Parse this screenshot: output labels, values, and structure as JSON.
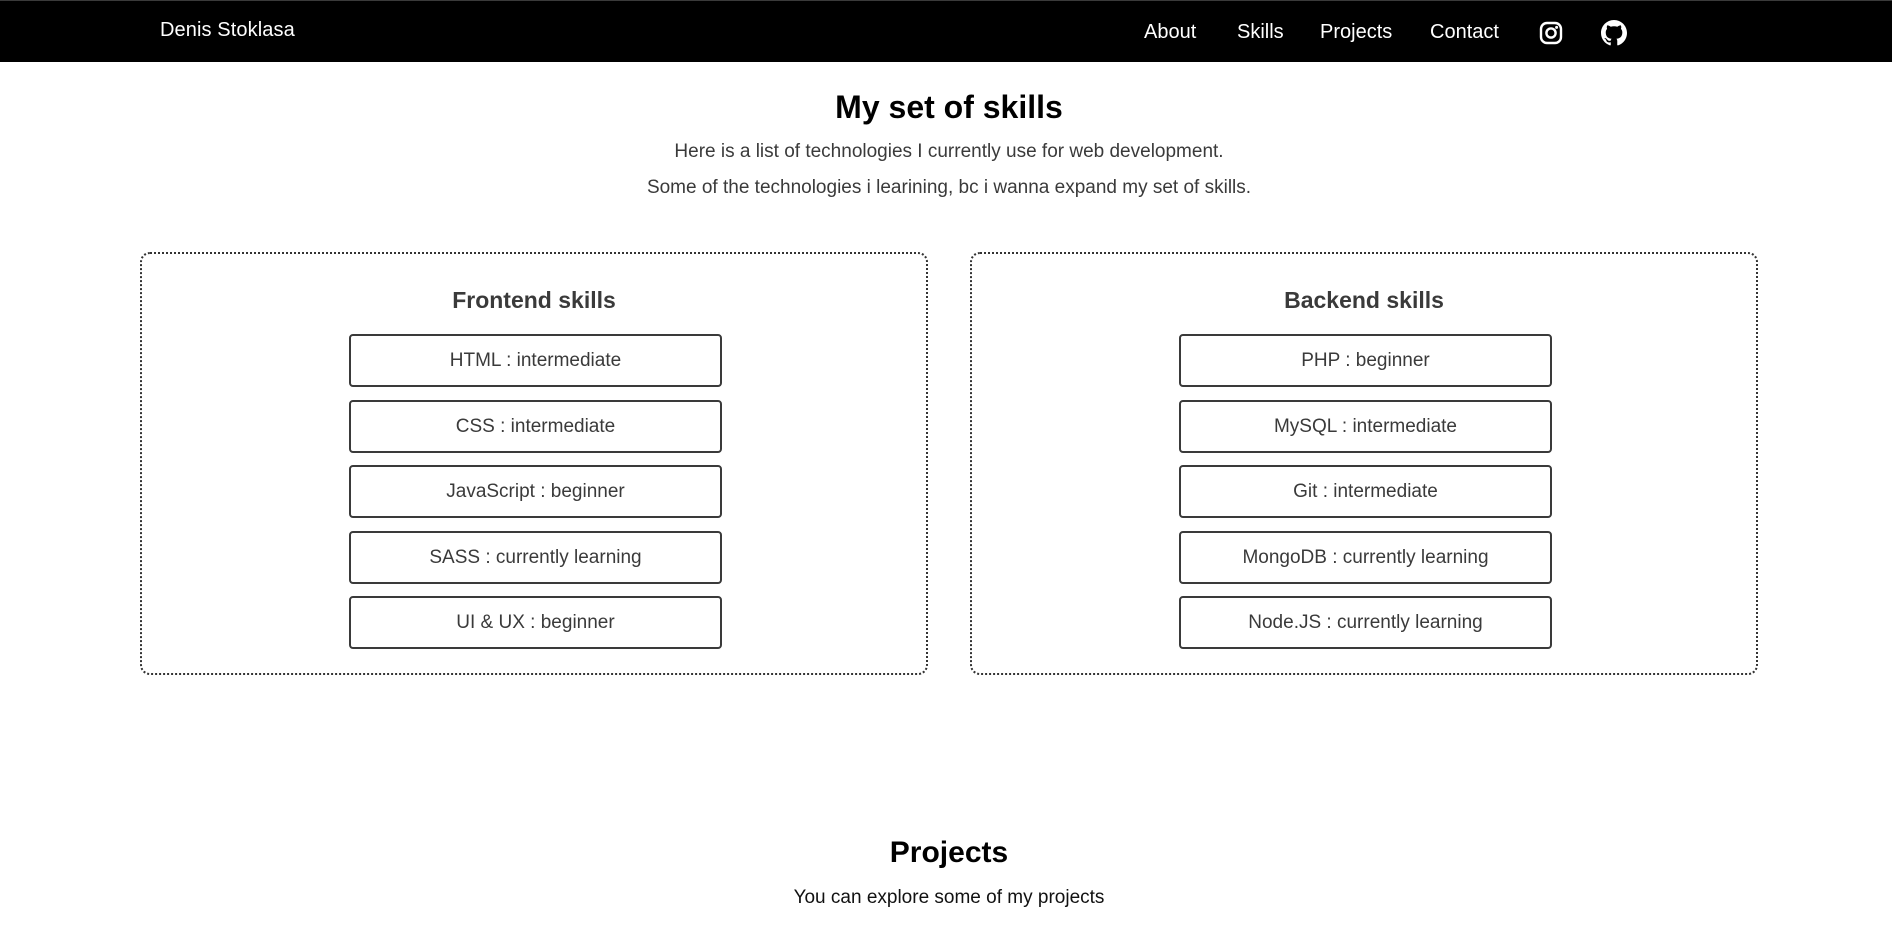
{
  "navbar": {
    "brand": "Denis Stoklasa",
    "links": [
      {
        "label": "About"
      },
      {
        "label": "Skills"
      },
      {
        "label": "Projects"
      },
      {
        "label": "Contact"
      }
    ],
    "icons": [
      "instagram-icon",
      "github-icon"
    ],
    "background": "#000000",
    "text_color": "#ffffff"
  },
  "skills": {
    "title": "My set of skills",
    "description_1": "Here is a list of technologies I currently use for web development.",
    "description_2": "Some of the technologies i learining, bc i wanna expand my set of skills.",
    "frontend": {
      "title": "Frontend skills",
      "items": [
        "HTML : intermediate",
        "CSS : intermediate",
        "JavaScript : beginner",
        "SASS : currently learning",
        "UI & UX : beginner"
      ]
    },
    "backend": {
      "title": "Backend skills",
      "items": [
        "PHP : beginner",
        "MySQL : intermediate",
        "Git : intermediate",
        "MongoDB : currently learning",
        "Node.JS : currently learning"
      ]
    }
  },
  "projects": {
    "title": "Projects",
    "description": "You can explore some of my projects"
  }
}
